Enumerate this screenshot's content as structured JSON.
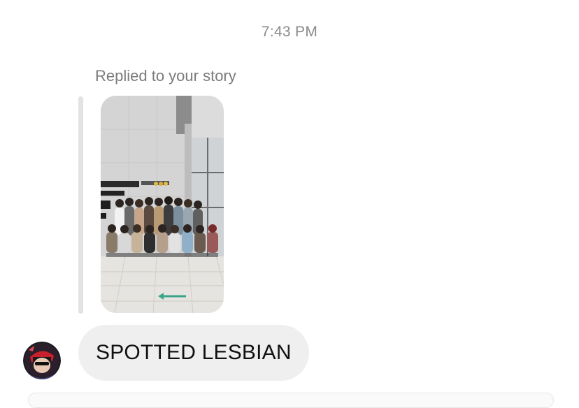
{
  "thread": {
    "timestamp": "7:43 PM",
    "reply_context": "Replied to your story",
    "message_text": "SPOTTED LESBIAN"
  },
  "story_preview": {
    "content": "group photo",
    "accent_arrow_color": "#3aa58a"
  },
  "sender": {
    "avatar": "avatar"
  },
  "colors": {
    "bubble": "#efefef",
    "timestamp_text": "#8a8a8a",
    "reply_bar": "#e3e3e3"
  }
}
